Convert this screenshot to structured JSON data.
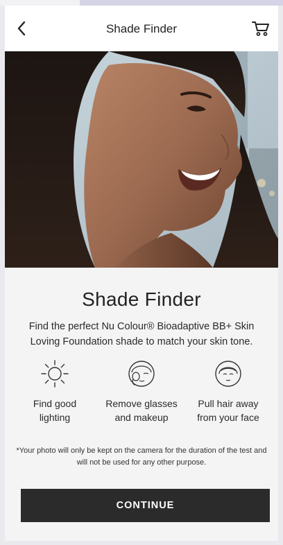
{
  "header": {
    "title": "Shade Finder",
    "back_icon": "chevron-left-icon",
    "cart_icon": "cart-icon"
  },
  "hero": {
    "image": "smiling-woman-photo"
  },
  "main": {
    "title": "Shade Finder",
    "description": "Find the perfect Nu Colour® Bioadaptive BB+ Skin Loving Foundation shade to match your skin tone."
  },
  "tips": [
    {
      "icon": "sun-icon",
      "label_line1": "Find good",
      "label_line2": "lighting"
    },
    {
      "icon": "face-wipe-icon",
      "label_line1": "Remove glasses",
      "label_line2": "and makeup"
    },
    {
      "icon": "face-hair-icon",
      "label_line1": "Pull hair away",
      "label_line2": "from your face"
    }
  ],
  "disclaimer": "*Your photo will only be kept on the camera for the duration of the test and will not be used for any other purpose.",
  "continue_label": "CONTINUE",
  "colors": {
    "button": "#2b2b2b",
    "background": "#f4f4f4",
    "header": "#ffffff"
  }
}
